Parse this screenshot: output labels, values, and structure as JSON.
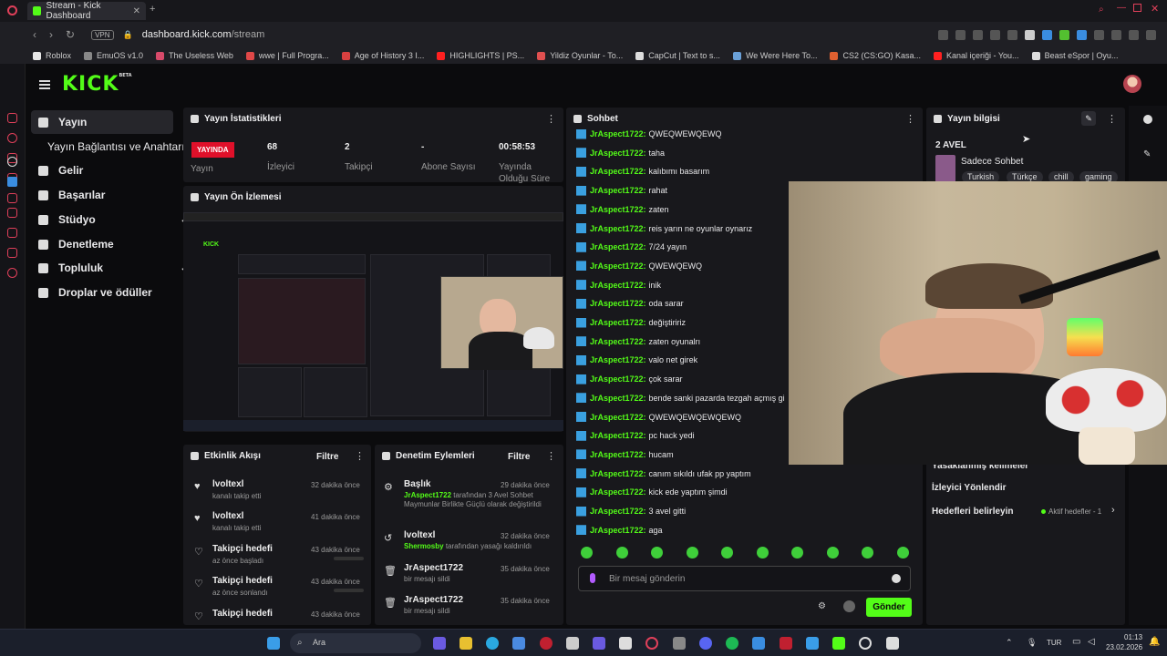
{
  "browser": {
    "tab_title": "Stream - Kick Dashboard",
    "url_host": "dashboard.kick.com",
    "url_path": "/stream",
    "vpn": "VPN",
    "bookmarks": [
      {
        "label": "Roblox",
        "color": "#e8e8e8"
      },
      {
        "label": "EmuOS v1.0",
        "color": "#888888"
      },
      {
        "label": "The Useless Web",
        "color": "#d84a6a"
      },
      {
        "label": "wwe | Full Progra...",
        "color": "#e04848"
      },
      {
        "label": "Age of History 3 I...",
        "color": "#d84040"
      },
      {
        "label": "HIGHLIGHTS | PS...",
        "color": "#ff2020"
      },
      {
        "label": "Yildiz Oyunlar - To...",
        "color": "#e05050"
      },
      {
        "label": "CapCut | Text to s...",
        "color": "#dddddd"
      },
      {
        "label": "We Were Here To...",
        "color": "#6aa0d8"
      },
      {
        "label": "CS2 (CS:GO) Kasa...",
        "color": "#e06030"
      },
      {
        "label": "Kanal içeriği - You...",
        "color": "#ff2020"
      },
      {
        "label": "Beast eSpor | Oyu...",
        "color": "#dddddd"
      }
    ]
  },
  "kick": {
    "logo": "KICK",
    "beta": "BETA"
  },
  "sidebar": {
    "items": [
      {
        "label": "Yayın"
      },
      {
        "label": "Yayın Bağlantısı ve Anahtarı"
      },
      {
        "label": "Gelir"
      },
      {
        "label": "Başarılar"
      },
      {
        "label": "Stüdyo"
      },
      {
        "label": "Denetleme"
      },
      {
        "label": "Topluluk"
      },
      {
        "label": "Droplar ve ödüller"
      }
    ]
  },
  "stats": {
    "title": "Yayın İstatistikleri",
    "live_badge": "YAYINDA",
    "live_label": "Yayın",
    "viewers": "68",
    "viewers_label": "İzleyici",
    "followers": "2",
    "followers_label": "Takipçi",
    "subs": "-",
    "subs_label": "Abone Sayısı",
    "uptime": "00:58:53",
    "uptime_label": "Yayında Olduğu Süre"
  },
  "preview": {
    "title": "Yayın Ön İzlemesi"
  },
  "activity": {
    "title": "Etkinlik Akışı",
    "filter": "Filtre",
    "rows": [
      {
        "title": "lvoltexl",
        "sub": "kanalı takip etti",
        "time": "32 dakika önce",
        "icon": "♥"
      },
      {
        "title": "lvoltexl",
        "sub": "kanalı takip etti",
        "time": "41 dakika önce",
        "icon": "♥"
      },
      {
        "title": "Takipçi hedefi",
        "sub": "az önce başladı",
        "time": "43 dakika önce",
        "icon": "♡"
      },
      {
        "title": "Takipçi hedefi",
        "sub": "az önce sonlandı",
        "time": "43 dakika önce",
        "icon": "♡"
      },
      {
        "title": "Takipçi hedefi",
        "sub": "",
        "time": "43 dakika önce",
        "icon": "♡"
      }
    ]
  },
  "moderation": {
    "title": "Denetim Eylemleri",
    "filter": "Filtre",
    "rows": [
      {
        "title": "Başlık",
        "actor": "JrAspect1722",
        "text": "tarafından 3 Avel Sohbet Maymunlar Birlikte Güçlü olarak değiştirildi",
        "time": "29 dakika önce",
        "icon": "⚙"
      },
      {
        "title": "lvoltexl",
        "actor": "Shermosby",
        "text": "tarafından yasağı kaldırıldı",
        "time": "32 dakika önce",
        "icon": "↺"
      },
      {
        "title": "JrAspect1722",
        "actor": "",
        "text": "bir mesajı sildi",
        "time": "35 dakika önce",
        "icon": "🗑"
      },
      {
        "title": "JrAspect1722",
        "actor": "",
        "text": "bir mesajı sildi",
        "time": "35 dakika önce",
        "icon": "🗑"
      }
    ]
  },
  "chat": {
    "title": "Sohbet",
    "messages": [
      {
        "user": "JrAspect1722:",
        "text": "QWEQWEWQEWQ"
      },
      {
        "user": "JrAspect1722:",
        "text": "taha"
      },
      {
        "user": "JrAspect1722:",
        "text": "kalıbımı basarım"
      },
      {
        "user": "JrAspect1722:",
        "text": "rahat"
      },
      {
        "user": "JrAspect1722:",
        "text": "zaten"
      },
      {
        "user": "JrAspect1722:",
        "text": "reis yarın ne oyunlar oynarız"
      },
      {
        "user": "JrAspect1722:",
        "text": "7/24 yayın"
      },
      {
        "user": "JrAspect1722:",
        "text": "QWEWQEWQ"
      },
      {
        "user": "JrAspect1722:",
        "text": "inik"
      },
      {
        "user": "JrAspect1722:",
        "text": "oda sarar"
      },
      {
        "user": "JrAspect1722:",
        "text": "değiştiririz"
      },
      {
        "user": "JrAspect1722:",
        "text": "zaten oyunalrı"
      },
      {
        "user": "JrAspect1722:",
        "text": "valo net girek"
      },
      {
        "user": "JrAspect1722:",
        "text": "çok sarar"
      },
      {
        "user": "JrAspect1722:",
        "text": "bende sanki pazarda tezgah açmış gi"
      },
      {
        "user": "JrAspect1722:",
        "text": "QWEWQEWQEWQEWQ"
      },
      {
        "user": "JrAspect1722:",
        "text": "pc hack yedi"
      },
      {
        "user": "JrAspect1722:",
        "text": "hucam"
      },
      {
        "user": "JrAspect1722:",
        "text": "canım sıkıldı ufak pp yaptım"
      },
      {
        "user": "JrAspect1722:",
        "text": "kick ede yaptım şimdi"
      },
      {
        "user": "JrAspect1722:",
        "text": "3 avel gitti"
      },
      {
        "user": "JrAspect1722:",
        "text": "aga"
      }
    ],
    "input_placeholder": "Bir mesaj gönderin",
    "send_label": "Gönder"
  },
  "info": {
    "title": "Yayın bilgisi",
    "stream_title": "2 AVEL",
    "category": "Sadece Sohbet",
    "tags": [
      "Turkish",
      "Türkçe",
      "chill",
      "gaming"
    ],
    "row_banned": "Yasaklanmış kelimeler",
    "row_redirect": "İzleyici Yönlendir",
    "row_goals": "Hedefleri belirleyin",
    "goals_status": "Aktif hedefler - 1"
  },
  "taskbar": {
    "search": "Ara",
    "lang": "TUR",
    "time": "01:13",
    "date": "23.02.2026"
  },
  "colors": {
    "accent": "#53fc18",
    "live": "#e0102a",
    "panel": "#18181c"
  }
}
